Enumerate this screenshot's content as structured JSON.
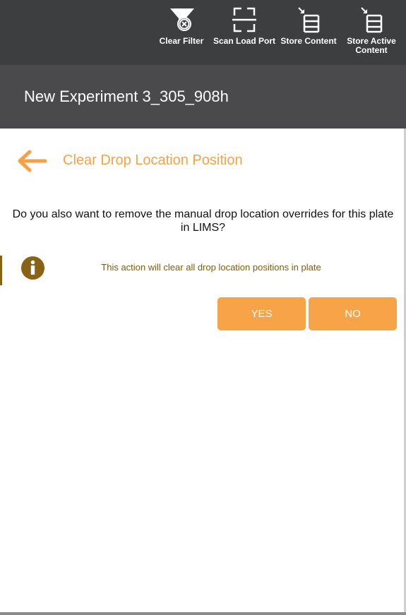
{
  "toolbar": {
    "items": [
      {
        "label": "Clear Filter",
        "icon": "clear-filter-icon"
      },
      {
        "label": "Scan Load Port",
        "icon": "scan-icon"
      },
      {
        "label": "Store Content",
        "icon": "store-content-icon"
      },
      {
        "label": "Store Active Content",
        "icon": "store-active-content-icon"
      }
    ]
  },
  "header": {
    "title": "New Experiment 3_305_908h"
  },
  "dialog": {
    "back_icon": "arrow-left-icon",
    "title": "Clear Drop Location Position",
    "question": "Do you also want to remove the manual drop location overrides for this plate in LIMS?",
    "info_icon": "info-icon",
    "info_text": "This action will clear all drop location positions in plate",
    "yes_label": "YES",
    "no_label": "NO"
  },
  "colors": {
    "toolbar_bg": "#3d3e40",
    "header_bg": "#4a4a4c",
    "accent": "#f6a145",
    "info": "#8a6214"
  }
}
